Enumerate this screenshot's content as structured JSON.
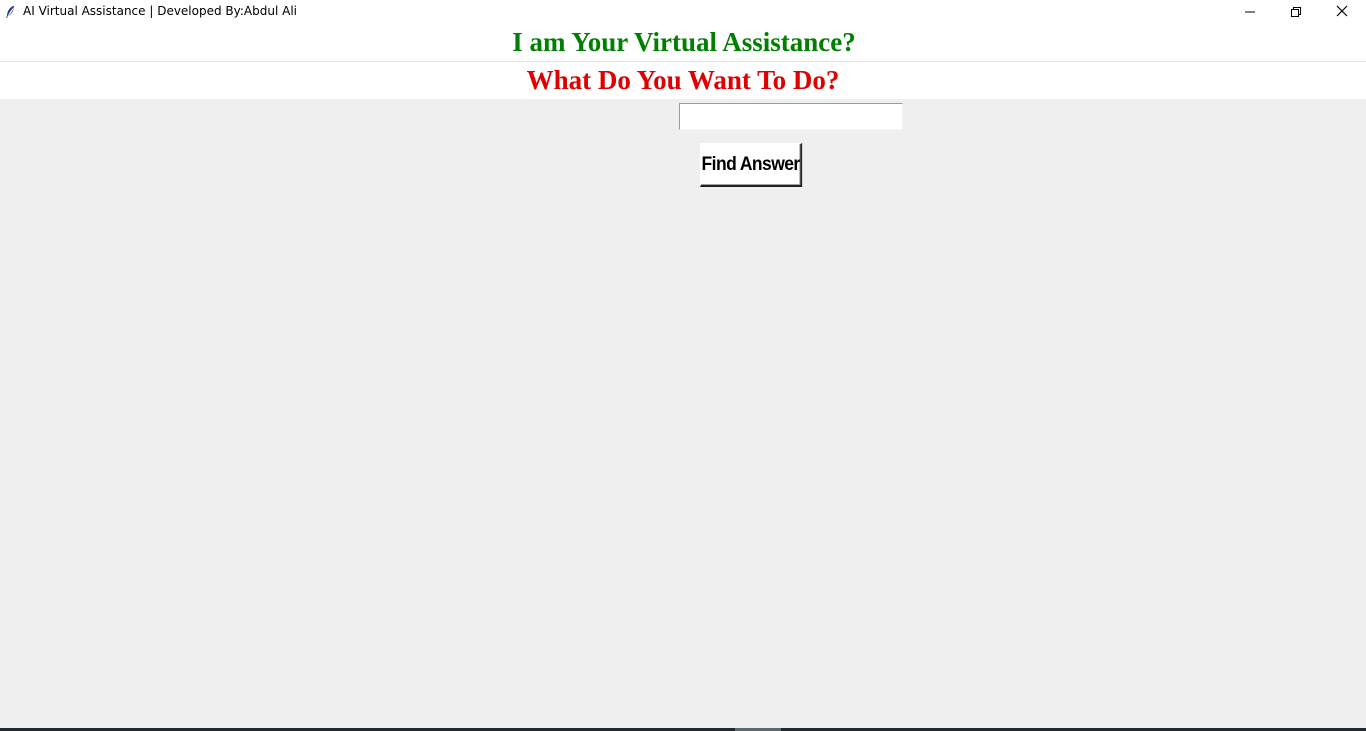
{
  "window": {
    "title": "AI Virtual Assistance | Developed By:Abdul Ali",
    "icon": "feather-icon",
    "controls": {
      "minimize": "minimize-icon",
      "maximize": "restore-icon",
      "close": "close-icon"
    }
  },
  "main": {
    "heading": "I am Your Virtual Assistance?",
    "subheading": "What Do You Want To Do?",
    "question_input": {
      "value": "",
      "placeholder": ""
    },
    "find_button_label": "Find Answer"
  },
  "colors": {
    "heading": "#008000",
    "subheading": "#e00000",
    "background": "#efefef"
  }
}
